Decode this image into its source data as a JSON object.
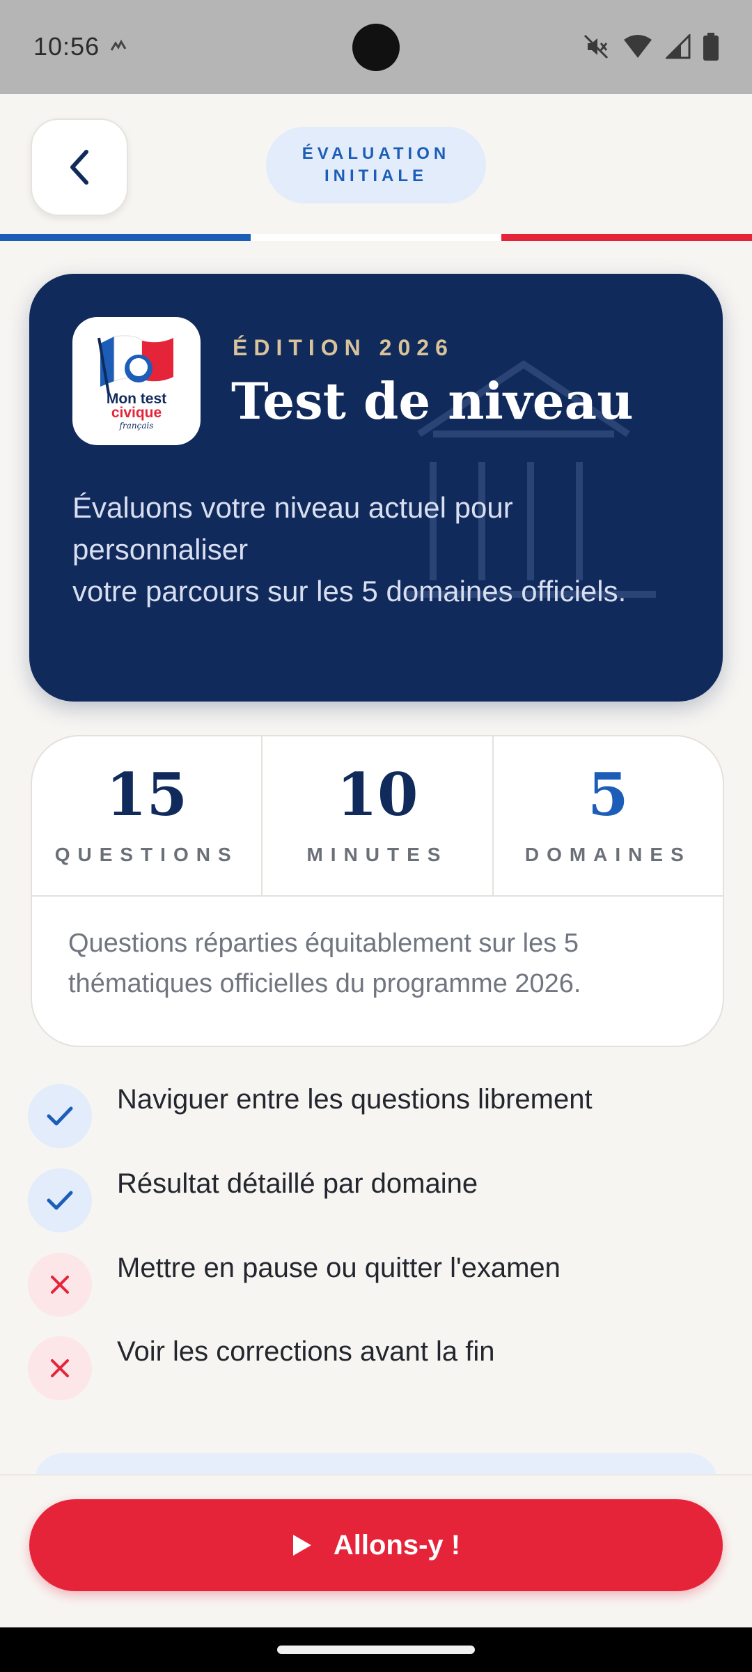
{
  "status_bar": {
    "time": "10:56"
  },
  "header": {
    "back_icon": "chevron-left-icon",
    "badge_line1": "ÉVALUATION",
    "badge_line2": "INITIALE"
  },
  "flag_colors": [
    "#1c5db8",
    "#ffffff",
    "#e5243a"
  ],
  "hero": {
    "edition": "ÉDITION 2026",
    "title": "Test de niveau",
    "description_line1": "Évaluons votre niveau actuel pour personnaliser",
    "description_line2": "votre parcours sur les 5 domaines officiels.",
    "logo": {
      "line1": "Mon test",
      "line2": "civique",
      "line3": "français"
    }
  },
  "stats": {
    "items": [
      {
        "value": "15",
        "label": "QUESTIONS"
      },
      {
        "value": "10",
        "label": "MINUTES"
      },
      {
        "value": "5",
        "label": "DOMAINES"
      }
    ],
    "note": "Questions réparties équitablement sur les 5 thématiques officielles du programme 2026."
  },
  "features": [
    {
      "icon": "check-icon",
      "allowed": true,
      "text": "Naviguer entre les questions librement"
    },
    {
      "icon": "check-icon",
      "allowed": true,
      "text": "Résultat détaillé par domaine"
    },
    {
      "icon": "cross-icon",
      "allowed": false,
      "text": "Mettre en pause ou quitter l'examen"
    },
    {
      "icon": "cross-icon",
      "allowed": false,
      "text": "Voir les corrections avant la fin"
    }
  ],
  "cta": {
    "label": "Allons-y !",
    "icon": "play-icon"
  },
  "colors": {
    "navy": "#112a5c",
    "blue": "#1c5db8",
    "red": "#e5243a",
    "gold": "#d8c39a"
  }
}
